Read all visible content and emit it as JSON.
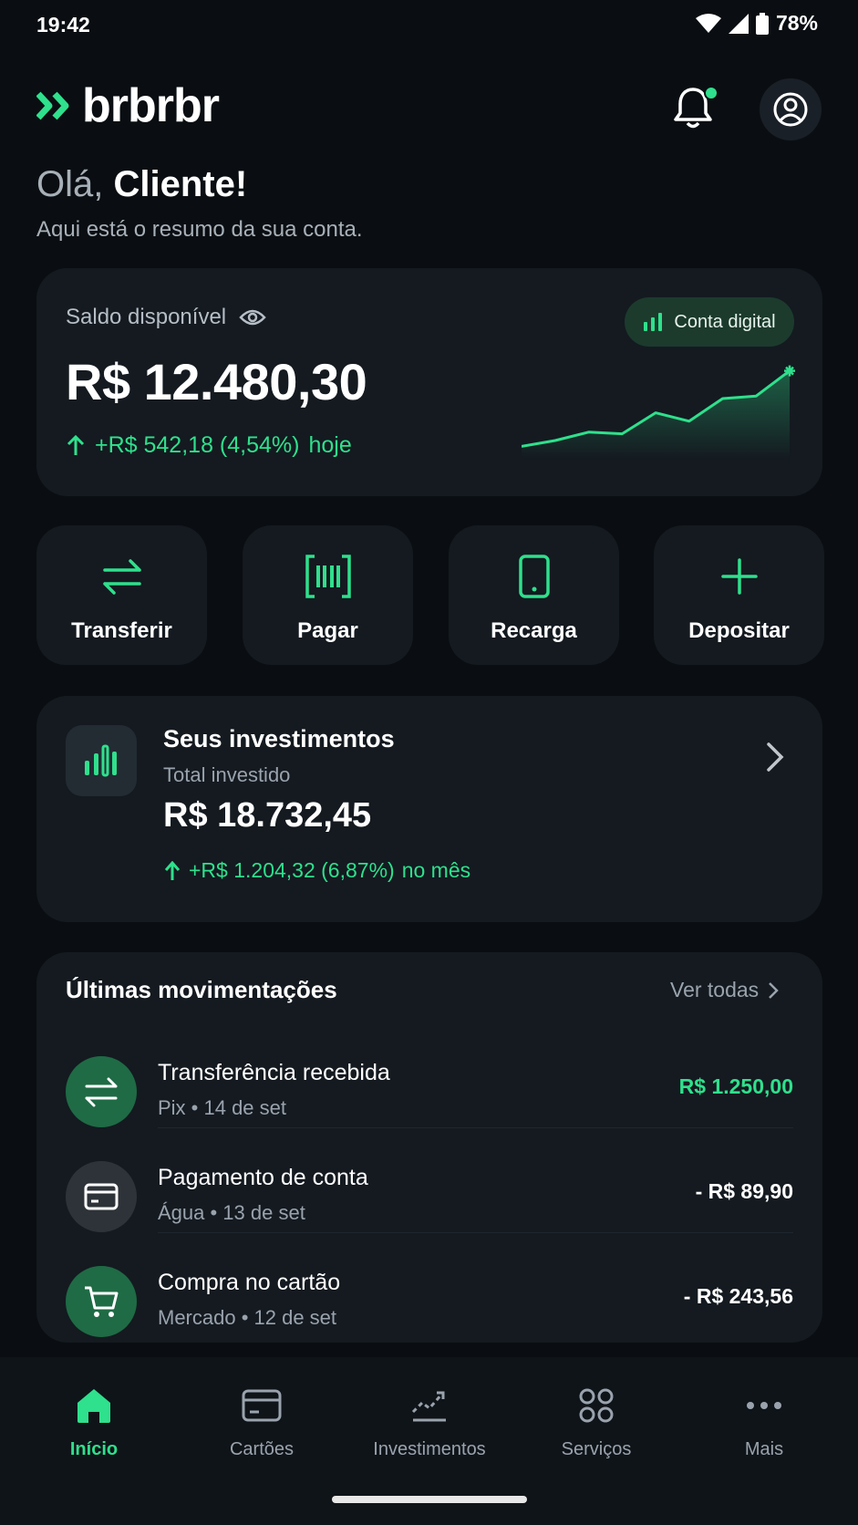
{
  "status_bar": {
    "time": "19:42",
    "battery": "78%"
  },
  "header": {
    "logo_text": "brbrbr"
  },
  "greeting": {
    "hello": "Olá,",
    "name": "Cliente!",
    "subtitle": "Aqui está o resumo da sua conta."
  },
  "balance": {
    "label": "Saldo disponível",
    "value": "R$ 12.480,30",
    "change": "+R$ 542,18 (4,54%)",
    "period": "hoje",
    "chip_label": "Conta digital",
    "sparkline": [
      0.05,
      0.12,
      0.22,
      0.2,
      0.45,
      0.35,
      0.62,
      0.65,
      0.95
    ]
  },
  "actions": [
    {
      "label": "Transferir",
      "icon": "transfer-icon"
    },
    {
      "label": "Pagar",
      "icon": "barcode-icon"
    },
    {
      "label": "Recarga",
      "icon": "phone-icon"
    },
    {
      "label": "Depositar",
      "icon": "plus-icon"
    }
  ],
  "investments": {
    "title": "Seus investimentos",
    "subtitle": "Total investido",
    "value": "R$ 18.732,45",
    "change": "+R$ 1.204,32 (6,87%)",
    "period": "no mês"
  },
  "transactions": {
    "title": "Últimas movimentações",
    "see_all": "Ver todas",
    "items": [
      {
        "title": "Transferência recebida",
        "meta": "Pix • 14 de set",
        "amount": "R$ 1.250,00",
        "color": "#2fe08c"
      },
      {
        "title": "Pagamento de conta",
        "meta": "Água • 13 de set",
        "amount": "- R$ 89,90",
        "color": "#ffffff"
      },
      {
        "title": "Compra no cartão",
        "meta": "Mercado • 12 de set",
        "amount": "- R$ 243,56",
        "color": "#ffffff"
      }
    ]
  },
  "bottom_nav": [
    {
      "label": "Início",
      "active": true
    },
    {
      "label": "Cartões",
      "active": false
    },
    {
      "label": "Investimentos",
      "active": false
    },
    {
      "label": "Serviços",
      "active": false
    },
    {
      "label": "Mais",
      "active": false
    }
  ],
  "colors": {
    "accent": "#2fe08c",
    "background": "#0a0e12",
    "card": "#141a20"
  }
}
